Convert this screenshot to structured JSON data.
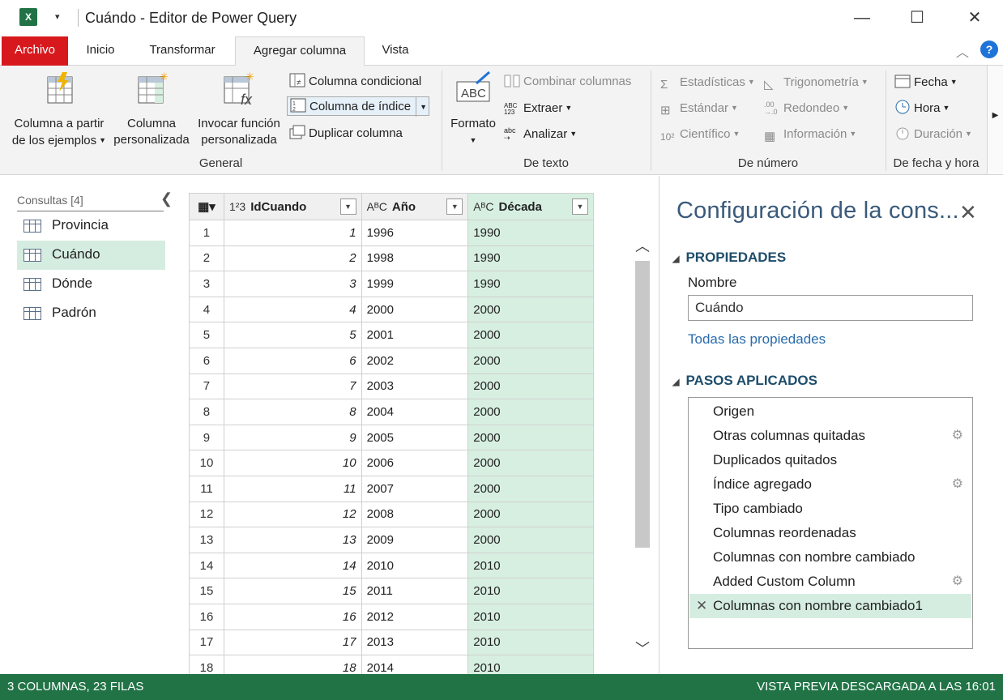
{
  "app": {
    "icon_letter": "X",
    "quick_access_icon": "dropdown-arrow-icon",
    "title": "Cuándo - Editor de Power Query"
  },
  "window": {
    "minimize": "—",
    "maximize": "☐",
    "close": "✕"
  },
  "tabs": [
    {
      "label": "Archivo"
    },
    {
      "label": "Inicio"
    },
    {
      "label": "Transformar"
    },
    {
      "label": "Agregar columna"
    },
    {
      "label": "Vista"
    }
  ],
  "ribbon": {
    "general": {
      "label": "General",
      "col_from_examples_l1": "Columna a partir",
      "col_from_examples_l2": "de los ejemplos",
      "custom_col_l1": "Columna",
      "custom_col_l2": "personalizada",
      "invoke_l1": "Invocar función",
      "invoke_l2": "personalizada",
      "conditional": "Columna condicional",
      "index": "Columna de índice",
      "duplicate": "Duplicar columna"
    },
    "text": {
      "label": "De texto",
      "format": "Formato",
      "merge": "Combinar columnas",
      "extract": "Extraer",
      "parse": "Analizar"
    },
    "number": {
      "label": "De número",
      "statistics": "Estadísticas",
      "standard": "Estándar",
      "scientific": "Científico",
      "trig": "Trigonometría",
      "rounding": "Redondeo",
      "info": "Información"
    },
    "datetime": {
      "label": "De fecha y hora",
      "date": "Fecha",
      "time": "Hora",
      "duration": "Duración"
    }
  },
  "queries": {
    "header": "Consultas [4]",
    "items": [
      {
        "name": "Provincia"
      },
      {
        "name": "Cuándo"
      },
      {
        "name": "Dónde"
      },
      {
        "name": "Padrón"
      }
    ]
  },
  "grid": {
    "columns": [
      {
        "type": "1²3",
        "name": "IdCuando"
      },
      {
        "type": "AᴮC",
        "name": "Año"
      },
      {
        "type": "AᴮC",
        "name": "Década"
      }
    ],
    "rows": [
      [
        "1",
        "1",
        "1996",
        "1990"
      ],
      [
        "2",
        "2",
        "1998",
        "1990"
      ],
      [
        "3",
        "3",
        "1999",
        "1990"
      ],
      [
        "4",
        "4",
        "2000",
        "2000"
      ],
      [
        "5",
        "5",
        "2001",
        "2000"
      ],
      [
        "6",
        "6",
        "2002",
        "2000"
      ],
      [
        "7",
        "7",
        "2003",
        "2000"
      ],
      [
        "8",
        "8",
        "2004",
        "2000"
      ],
      [
        "9",
        "9",
        "2005",
        "2000"
      ],
      [
        "10",
        "10",
        "2006",
        "2000"
      ],
      [
        "11",
        "11",
        "2007",
        "2000"
      ],
      [
        "12",
        "12",
        "2008",
        "2000"
      ],
      [
        "13",
        "13",
        "2009",
        "2000"
      ],
      [
        "14",
        "14",
        "2010",
        "2010"
      ],
      [
        "15",
        "15",
        "2011",
        "2010"
      ],
      [
        "16",
        "16",
        "2012",
        "2010"
      ],
      [
        "17",
        "17",
        "2013",
        "2010"
      ],
      [
        "18",
        "18",
        "2014",
        "2010"
      ]
    ]
  },
  "settings": {
    "title": "Configuración de la cons...",
    "properties": "PROPIEDADES",
    "name_label": "Nombre",
    "name_value": "Cuándo",
    "all_props": "Todas las propiedades",
    "steps_header": "PASOS APLICADOS",
    "steps": [
      {
        "label": "Origen",
        "gear": false
      },
      {
        "label": "Otras columnas quitadas",
        "gear": true
      },
      {
        "label": "Duplicados quitados",
        "gear": false
      },
      {
        "label": "Índice agregado",
        "gear": true
      },
      {
        "label": "Tipo cambiado",
        "gear": false
      },
      {
        "label": "Columnas reordenadas",
        "gear": false
      },
      {
        "label": "Columnas con nombre cambiado",
        "gear": false
      },
      {
        "label": "Added Custom Column",
        "gear": true
      },
      {
        "label": "Columnas con nombre cambiado1",
        "gear": false
      }
    ]
  },
  "status": {
    "left": "3 COLUMNAS, 23 FILAS",
    "right": "VISTA PREVIA DESCARGADA A LAS 16:01"
  },
  "colors": {
    "accent_green": "#217346",
    "selection_green": "#d5ede0",
    "file_tab_red": "#d7191d"
  }
}
